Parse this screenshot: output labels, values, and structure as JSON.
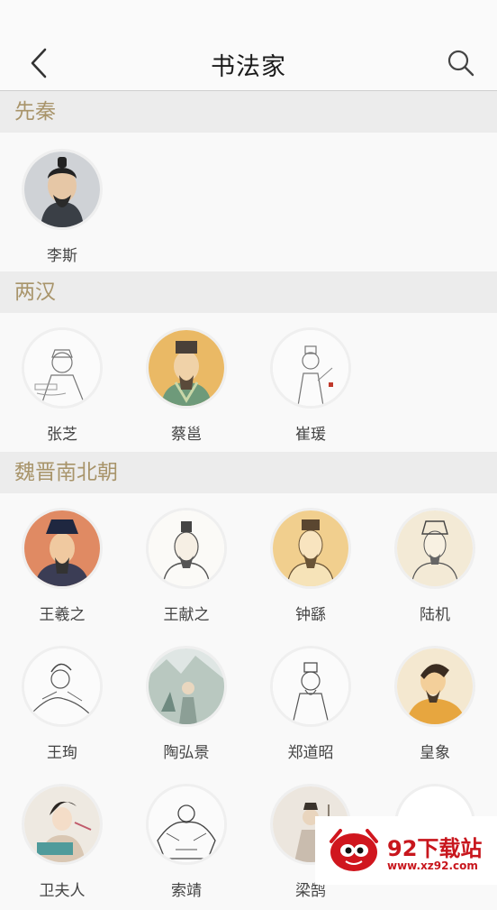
{
  "header": {
    "title": "书法家"
  },
  "sections": [
    {
      "title": "先秦",
      "people": [
        {
          "name": "李斯"
        }
      ]
    },
    {
      "title": "两汉",
      "people": [
        {
          "name": "张芝"
        },
        {
          "name": "蔡邕"
        },
        {
          "name": "崔瑗"
        }
      ]
    },
    {
      "title": "魏晋南北朝",
      "people": [
        {
          "name": "王羲之"
        },
        {
          "name": "王献之"
        },
        {
          "name": "钟繇"
        },
        {
          "name": "陆机"
        },
        {
          "name": "王珣"
        },
        {
          "name": "陶弘景"
        },
        {
          "name": "郑道昭"
        },
        {
          "name": "皇象"
        },
        {
          "name": "卫夫人"
        },
        {
          "name": "索靖"
        },
        {
          "name": "梁鹄"
        },
        {
          "name": ""
        }
      ]
    }
  ],
  "watermark": {
    "brand": "92下载站",
    "url": "www.xz92.com"
  }
}
